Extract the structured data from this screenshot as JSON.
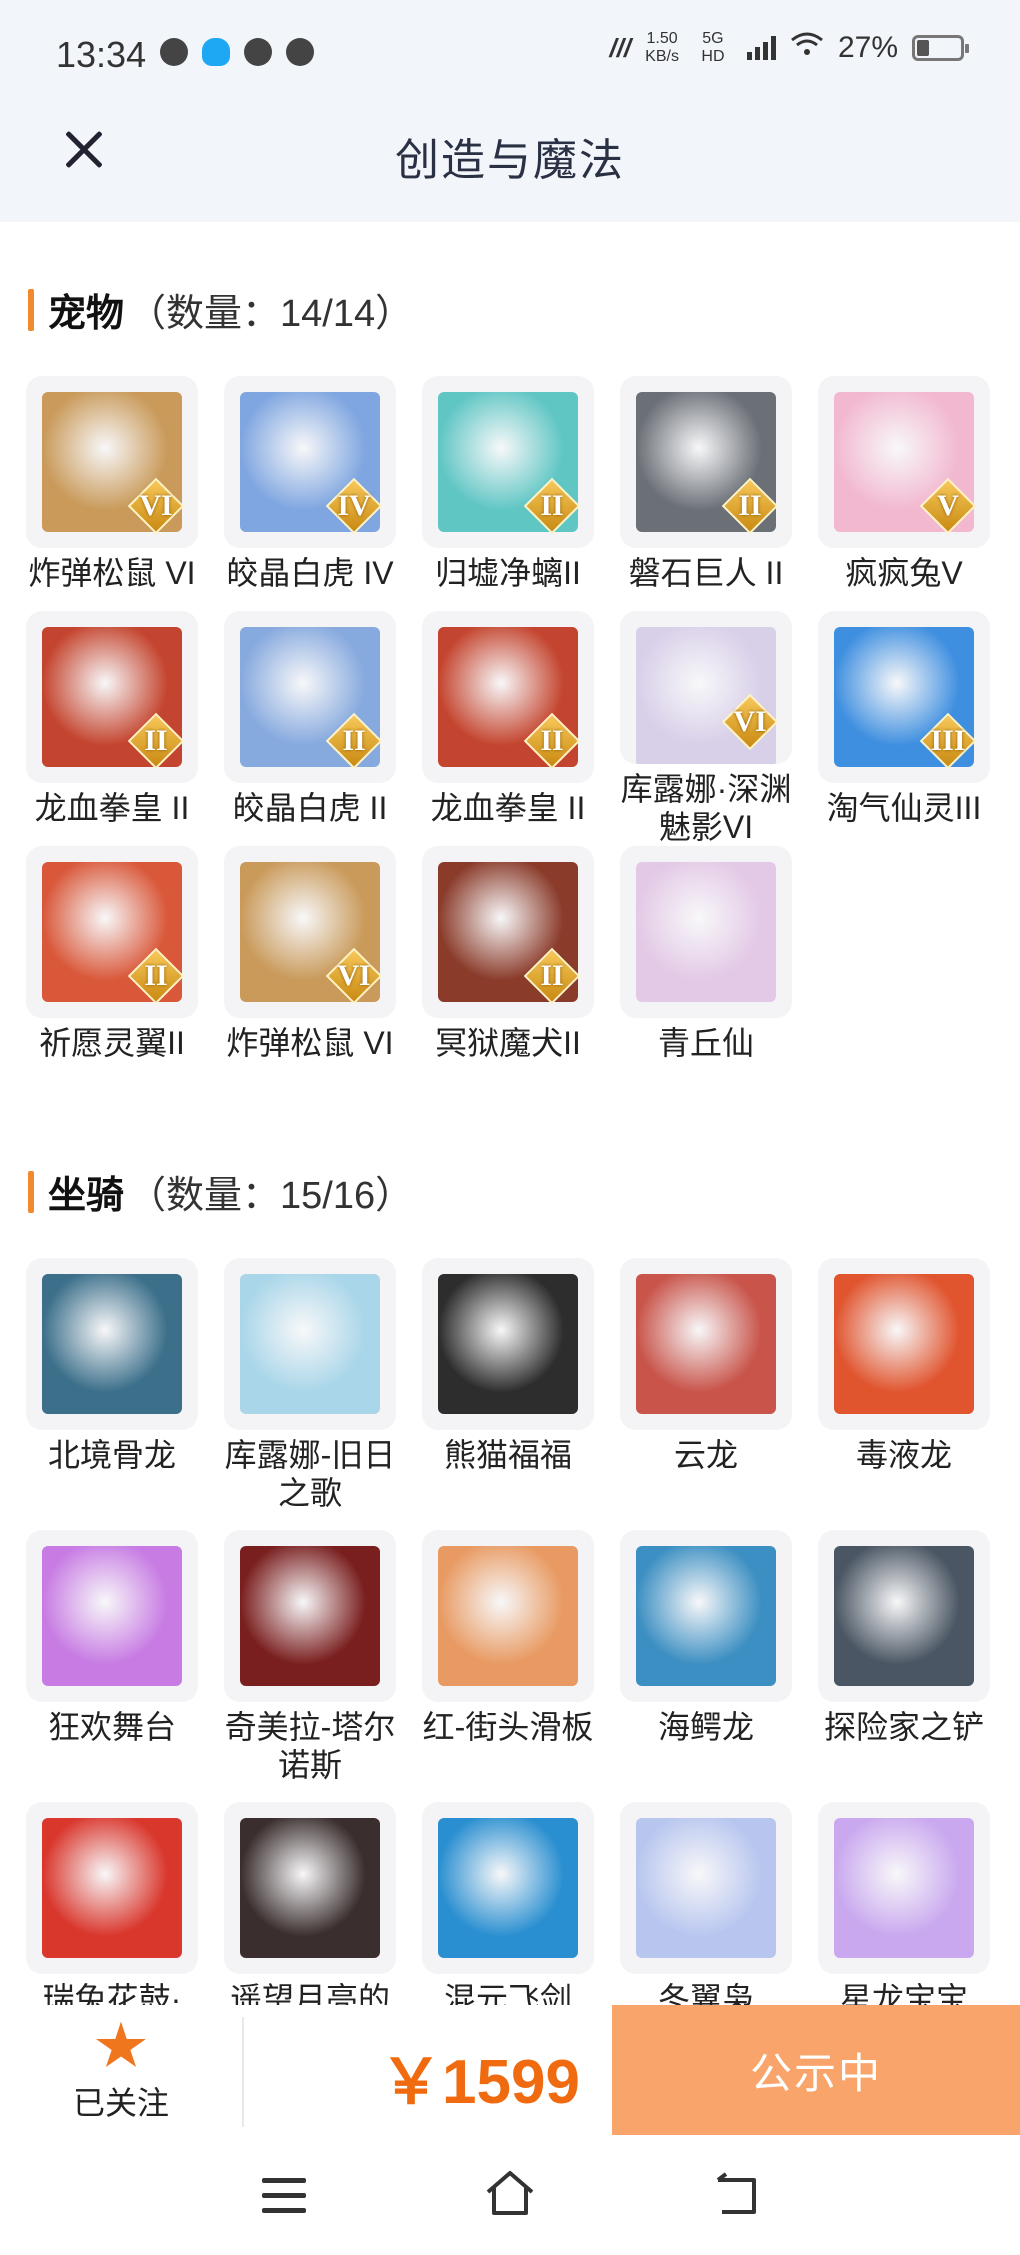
{
  "status_bar": {
    "time": "13:34",
    "net_speed": "1.50",
    "net_unit": "KB/s",
    "network": "5G HD",
    "battery": "27%"
  },
  "header": {
    "title": "创造与魔法"
  },
  "pets": {
    "name": "宠物",
    "count": "（数量：14/14）",
    "items": [
      {
        "label": "炸弹松鼠 VI",
        "badge": "VI",
        "icon": "squirrel",
        "color": "#c99a5a"
      },
      {
        "label": "皎晶白虎 IV",
        "badge": "IV",
        "icon": "white-tiger",
        "color": "#7fa6e0"
      },
      {
        "label": "归墟净螭II",
        "badge": "II",
        "icon": "sea-dragon",
        "color": "#5fc6c4"
      },
      {
        "label": "磐石巨人 II",
        "badge": "II",
        "icon": "stone-golem",
        "color": "#6b7077"
      },
      {
        "label": "疯疯兔V",
        "badge": "V",
        "icon": "rabbit",
        "color": "#f2b8d0"
      },
      {
        "label": "龙血拳皇 II",
        "badge": "II",
        "icon": "dragon-boxer",
        "color": "#c4452f"
      },
      {
        "label": "皎晶白虎 II",
        "badge": "II",
        "icon": "white-tiger",
        "color": "#86a9de"
      },
      {
        "label": "龙血拳皇 II",
        "badge": "II",
        "icon": "dragon-boxer",
        "color": "#c4452f"
      },
      {
        "label": "库露娜·深渊魅影VI",
        "badge": "VI",
        "icon": "kuluna-phantom",
        "color": "#d8cfe9"
      },
      {
        "label": "淘气仙灵III",
        "badge": "III",
        "icon": "blue-puppy",
        "color": "#3f8fe0"
      },
      {
        "label": "祈愿灵翼II",
        "badge": "II",
        "icon": "bird",
        "color": "#d9583a"
      },
      {
        "label": "炸弹松鼠 VI",
        "badge": "VI",
        "icon": "squirrel",
        "color": "#c99a5a"
      },
      {
        "label": "冥狱魔犬II",
        "badge": "II",
        "icon": "hell-hound",
        "color": "#8a3b2a"
      },
      {
        "label": "青丘仙",
        "badge": "",
        "icon": "fox-fairy",
        "color": "#e3c9e6"
      }
    ]
  },
  "mounts": {
    "name": "坐骑",
    "count": "（数量：15/16）",
    "items": [
      {
        "label": "北境骨龙",
        "icon": "bone-dragon",
        "color": "#3b6f8a"
      },
      {
        "label": "库露娜-旧日之歌",
        "icon": "kuluna-song",
        "color": "#a9d6e9"
      },
      {
        "label": "熊猫福福",
        "icon": "panda",
        "color": "#2d2d2d"
      },
      {
        "label": "云龙",
        "icon": "cloud-dragon",
        "color": "#c8544a"
      },
      {
        "label": "毒液龙",
        "icon": "venom-dragon",
        "color": "#e0542e"
      },
      {
        "label": "狂欢舞台",
        "icon": "dance-stage",
        "color": "#c77be3"
      },
      {
        "label": "奇美拉-塔尔诺斯",
        "icon": "chimera",
        "color": "#7a1f1f"
      },
      {
        "label": "红-街头滑板",
        "icon": "skateboard",
        "color": "#e89a62"
      },
      {
        "label": "海鳄龙",
        "icon": "sea-crocodile-dragon",
        "color": "#3c8fc2"
      },
      {
        "label": "探险家之铲",
        "icon": "shovel",
        "color": "#4a5663"
      },
      {
        "label": "瑞兔花鼓·",
        "icon": "rabbit-drum",
        "color": "#d9362c"
      },
      {
        "label": "遥望月亮的",
        "icon": "pig",
        "color": "#3a2e2e"
      },
      {
        "label": "混元飞剑",
        "icon": "flying-sword",
        "color": "#2a8fd0"
      },
      {
        "label": "冬翼枭",
        "icon": "snow-owl",
        "color": "#b8c6ef"
      },
      {
        "label": "星龙宝宝",
        "icon": "star-dragon-baby",
        "color": "#c9a8ef"
      }
    ]
  },
  "footer": {
    "follow_label": "已关注",
    "price": "￥1599",
    "status_label": "公示中"
  },
  "colors": {
    "accent": "#f06a0f",
    "section_bar": "#f08a2c",
    "status_button": "#f9a46a"
  }
}
